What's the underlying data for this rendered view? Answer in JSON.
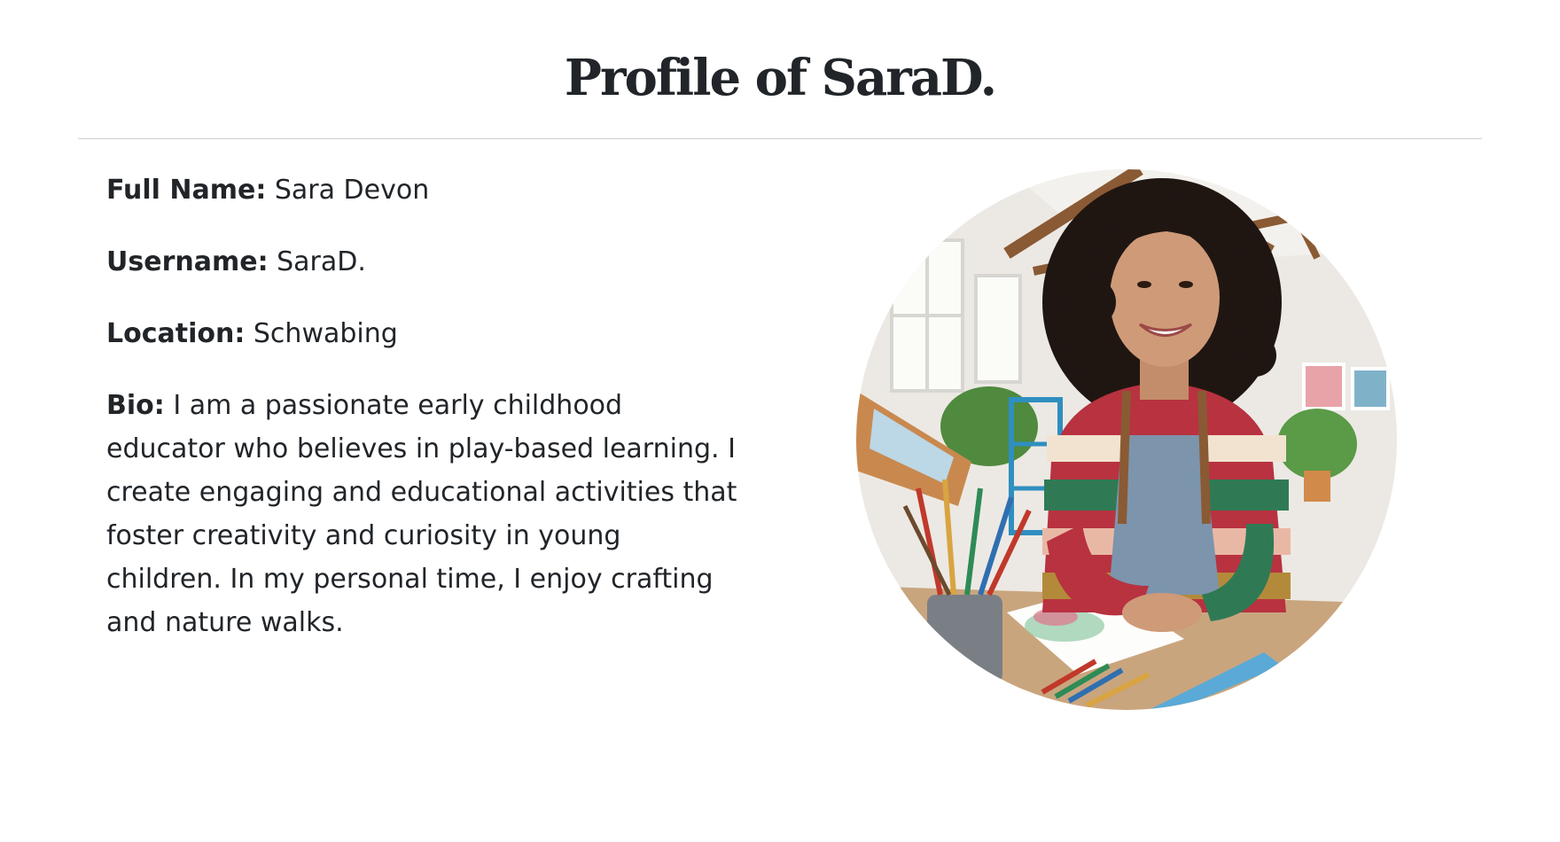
{
  "page": {
    "title": "Profile of SaraD."
  },
  "profile": {
    "full_name": {
      "label": "Full Name:",
      "value": "Sara Devon"
    },
    "username": {
      "label": "Username:",
      "value": "SaraD."
    },
    "location": {
      "label": "Location:",
      "value": "Schwabing"
    },
    "bio": {
      "label": "Bio:",
      "value": "I am a passionate early childhood educator who believes in play-based learning. I create engaging and educational activities that foster creativity and curiosity in young children. In my personal time, I enjoy crafting and nature walks."
    }
  },
  "avatar": {
    "icon": "profile-photo"
  }
}
